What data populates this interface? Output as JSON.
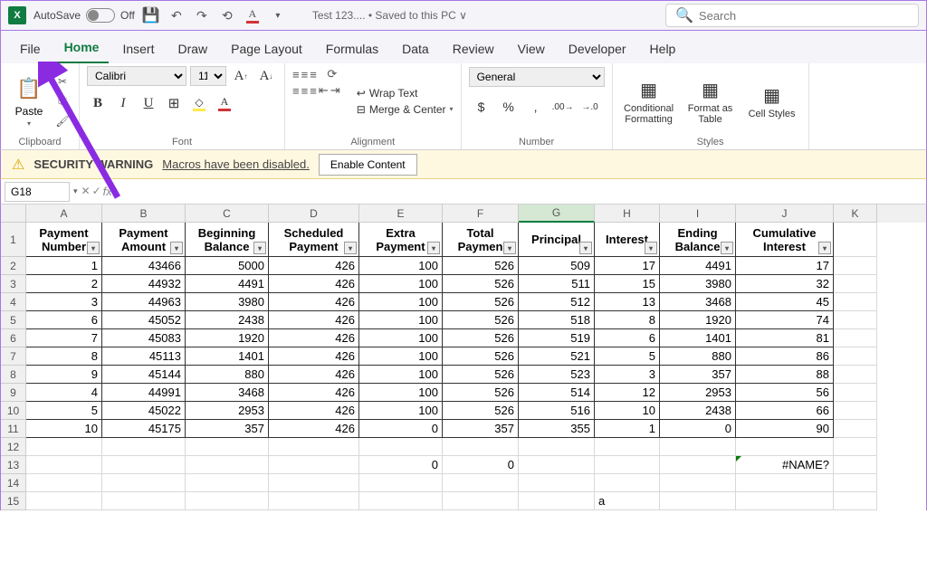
{
  "title": {
    "autosave": "AutoSave",
    "autosave_state": "Off",
    "filename": "Test 123.... • Saved to this PC ∨",
    "search_placeholder": "Search"
  },
  "tabs": [
    "File",
    "Home",
    "Insert",
    "Draw",
    "Page Layout",
    "Formulas",
    "Data",
    "Review",
    "View",
    "Developer",
    "Help"
  ],
  "active_tab": "Home",
  "ribbon": {
    "clipboard_label": "Clipboard",
    "paste": "Paste",
    "font_label": "Font",
    "font_name": "Calibri",
    "font_size": "11",
    "alignment_label": "Alignment",
    "wrap": "Wrap Text",
    "merge": "Merge & Center",
    "number_label": "Number",
    "number_format": "General",
    "styles_label": "Styles",
    "cond_fmt": "Conditional Formatting",
    "fmt_table": "Format as Table",
    "cell_styles": "Cell Styles"
  },
  "warning": {
    "title": "SECURITY WARNING",
    "msg": "Macros have been disabled.",
    "enable": "Enable Content"
  },
  "namebox": "G18",
  "columns": [
    "A",
    "B",
    "C",
    "D",
    "E",
    "F",
    "G",
    "H",
    "I",
    "J",
    "K"
  ],
  "selected_col": "G",
  "headers": [
    "Payment Number",
    "Payment Amount",
    "Beginning Balance",
    "Scheduled Payment",
    "Extra Payment",
    "Total Paymen",
    "Principal",
    "Interest",
    "Ending Balance",
    "Cumulative Interest"
  ],
  "rows": [
    {
      "n": 2,
      "d": [
        "1",
        "43466",
        "5000",
        "426",
        "100",
        "526",
        "509",
        "17",
        "4491",
        "17"
      ]
    },
    {
      "n": 3,
      "d": [
        "2",
        "44932",
        "4491",
        "426",
        "100",
        "526",
        "511",
        "15",
        "3980",
        "32"
      ]
    },
    {
      "n": 4,
      "d": [
        "3",
        "44963",
        "3980",
        "426",
        "100",
        "526",
        "512",
        "13",
        "3468",
        "45"
      ]
    },
    {
      "n": 5,
      "d": [
        "6",
        "45052",
        "2438",
        "426",
        "100",
        "526",
        "518",
        "8",
        "1920",
        "74"
      ]
    },
    {
      "n": 6,
      "d": [
        "7",
        "45083",
        "1920",
        "426",
        "100",
        "526",
        "519",
        "6",
        "1401",
        "81"
      ]
    },
    {
      "n": 7,
      "d": [
        "8",
        "45113",
        "1401",
        "426",
        "100",
        "526",
        "521",
        "5",
        "880",
        "86"
      ]
    },
    {
      "n": 8,
      "d": [
        "9",
        "45144",
        "880",
        "426",
        "100",
        "526",
        "523",
        "3",
        "357",
        "88"
      ]
    },
    {
      "n": 9,
      "d": [
        "4",
        "44991",
        "3468",
        "426",
        "100",
        "526",
        "514",
        "12",
        "2953",
        "56"
      ]
    },
    {
      "n": 10,
      "d": [
        "5",
        "45022",
        "2953",
        "426",
        "100",
        "526",
        "516",
        "10",
        "2438",
        "66"
      ]
    },
    {
      "n": 11,
      "d": [
        "10",
        "45175",
        "357",
        "426",
        "0",
        "357",
        "355",
        "1",
        "0",
        "90"
      ]
    }
  ],
  "extra_rows": {
    "13": {
      "E": "0",
      "F": "0",
      "J": "#NAME?"
    },
    "15": {
      "H": "a"
    }
  }
}
